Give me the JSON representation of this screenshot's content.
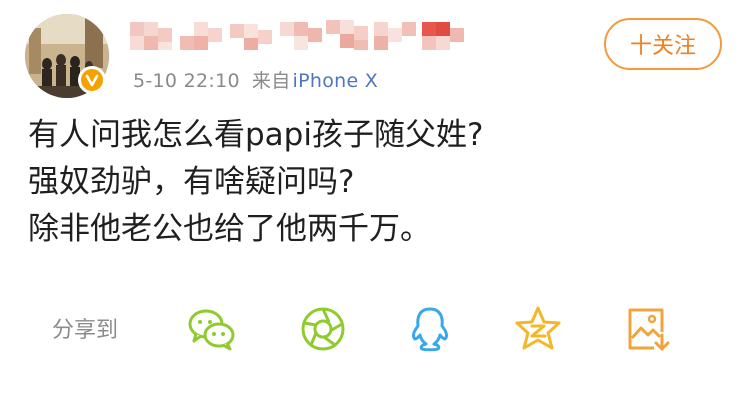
{
  "post_header": {
    "timestamp": "5-10 22:10",
    "source_prefix": "来自",
    "device": "iPhone X",
    "follow_label": "十关注"
  },
  "post_body": {
    "lines": [
      "有人问我怎么看papi孩子随父姓?",
      "强奴劲驴，有啥疑问吗?",
      "除非他老公也给了他两千万。"
    ]
  },
  "share_bar": {
    "label": "分享到",
    "targets": [
      {
        "icon": "wechat-icon",
        "color": "#8fcb2f"
      },
      {
        "icon": "moments-icon",
        "color": "#8fcb2f"
      },
      {
        "icon": "qq-icon",
        "color": "#3aa8e8"
      },
      {
        "icon": "qzone-icon",
        "color": "#f5b72a"
      },
      {
        "icon": "save-image-icon",
        "color": "#f2a43a"
      }
    ]
  },
  "colors": {
    "accent_orange": "#f07f1c",
    "link_blue": "#4e78b8",
    "meta_gray": "#8a8a8a",
    "text_dark": "#1f1f1f"
  }
}
